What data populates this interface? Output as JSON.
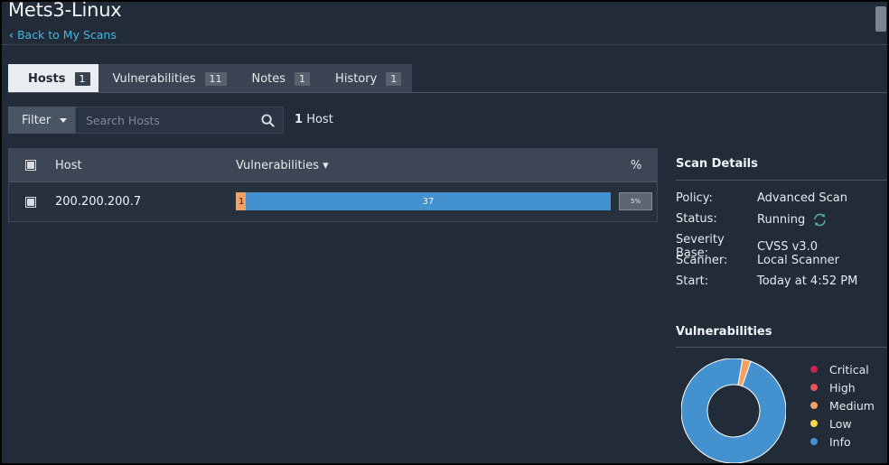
{
  "page": {
    "title": "Mets3-Linux",
    "back_link": "Back to My Scans"
  },
  "tabs": [
    {
      "label": "Hosts",
      "count": "1",
      "active": true
    },
    {
      "label": "Vulnerabilities",
      "count": "11"
    },
    {
      "label": "Notes",
      "count": "1"
    },
    {
      "label": "History",
      "count": "1"
    }
  ],
  "toolbar": {
    "filter_label": "Filter",
    "search_placeholder": "Search Hosts",
    "host_count_num": "1",
    "host_count_label": "Host"
  },
  "table": {
    "columns": {
      "host": "Host",
      "vulnerabilities": "Vulnerabilities ▾",
      "percent": "%"
    },
    "rows": [
      {
        "host": "200.200.200.7",
        "medium": "1",
        "info": "37",
        "percent": "5%"
      }
    ]
  },
  "scan_details": {
    "title": "Scan Details",
    "rows": [
      {
        "key": "Policy:",
        "value": "Advanced Scan"
      },
      {
        "key": "Status:",
        "value": "Running"
      },
      {
        "key": "Severity Base:",
        "value": "CVSS v3.0"
      },
      {
        "key": "Scanner:",
        "value": "Local Scanner"
      },
      {
        "key": "Start:",
        "value": "Today at 4:52 PM"
      }
    ]
  },
  "vulnerabilities_panel": {
    "title": "Vulnerabilities",
    "legend": [
      {
        "label": "Critical",
        "color": "#c8234f"
      },
      {
        "label": "High",
        "color": "#e9525a"
      },
      {
        "label": "Medium",
        "color": "#f5a05f"
      },
      {
        "label": "Low",
        "color": "#fcd84a"
      },
      {
        "label": "Info",
        "color": "#4491cf"
      }
    ]
  },
  "chart_data": {
    "type": "pie",
    "categories": [
      "Critical",
      "High",
      "Medium",
      "Low",
      "Info"
    ],
    "values": [
      0,
      0,
      1,
      0,
      37
    ]
  },
  "colors": {
    "accent_link": "#41b7e0",
    "medium": "#f5a05f",
    "info": "#4491cf",
    "running_icon": "#5fa8a0"
  }
}
